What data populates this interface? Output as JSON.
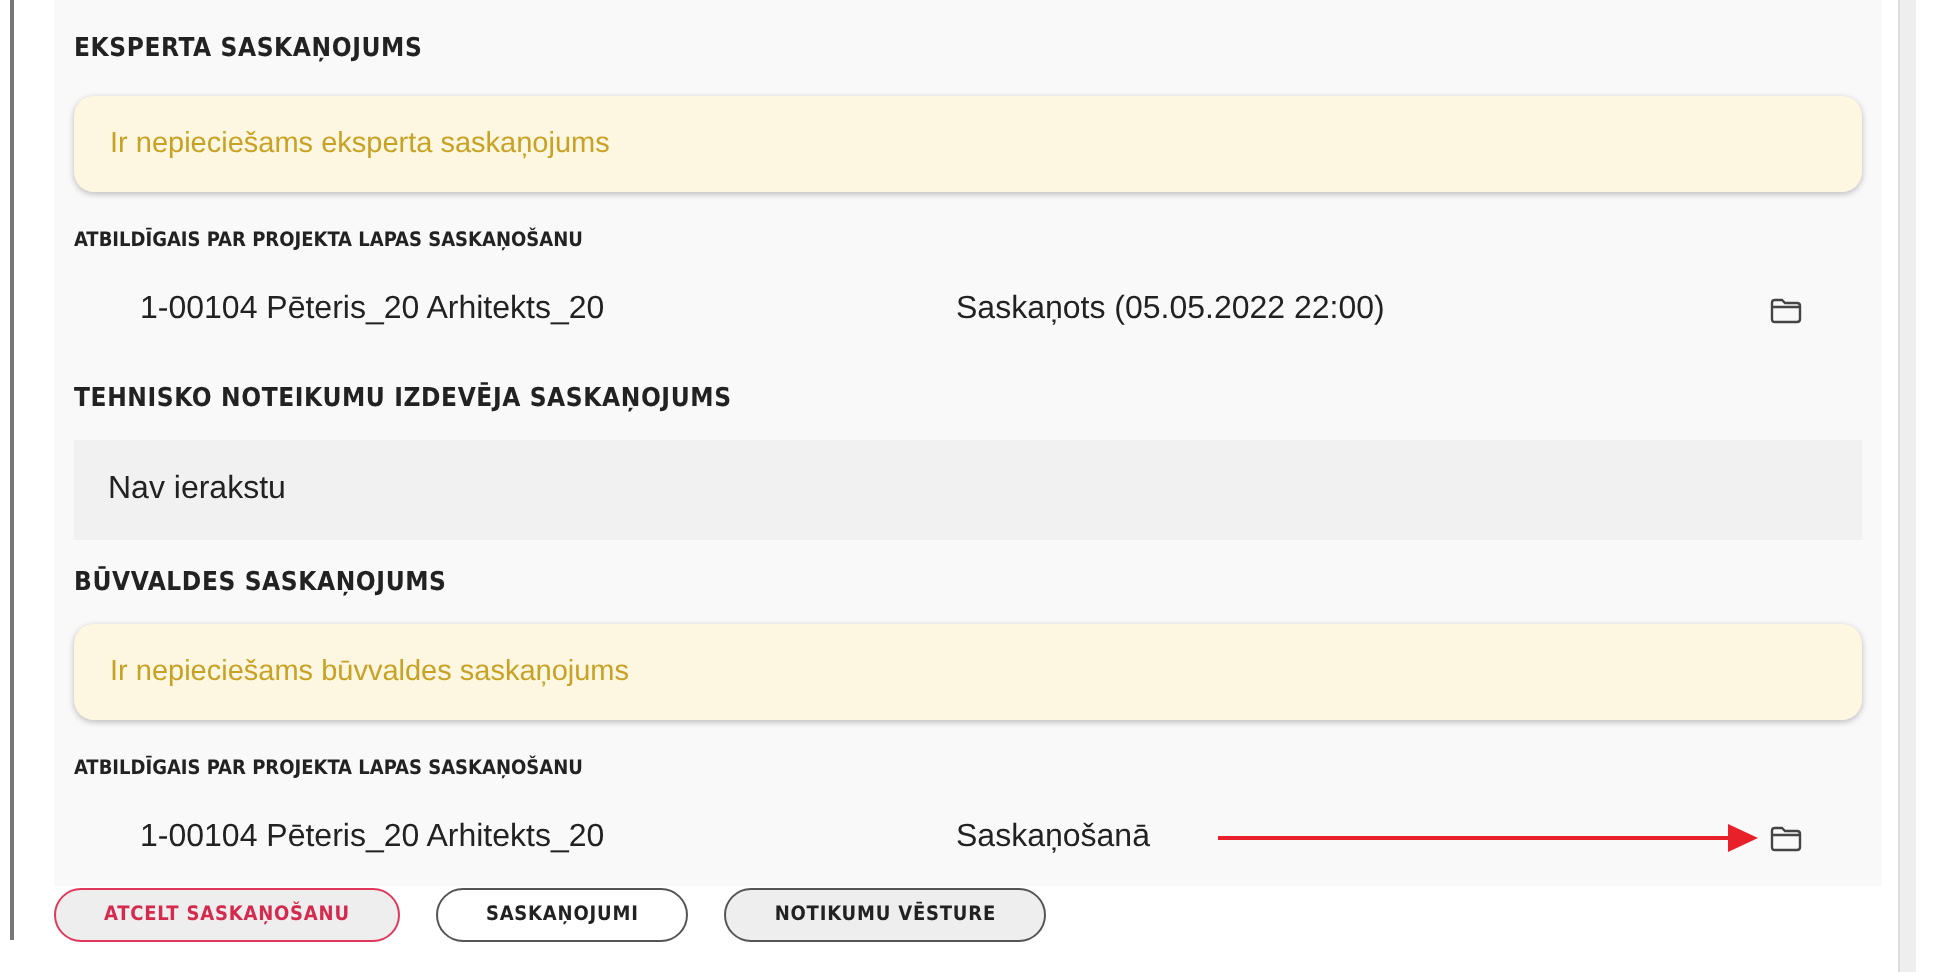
{
  "sections": [
    {
      "title": "EKSPERTA SASKAŅOJUMS",
      "blocks": [
        {
          "kind": "alert",
          "text": "Ir nepieciešams eksperta saskaņojums"
        },
        {
          "kind": "responsible",
          "label": "ATBILDĪGAIS PAR PROJEKTA LAPAS SASKAŅOŠANU",
          "rows": [
            {
              "name": "1-00104 Pēteris_20 Arhitekts_20",
              "status": "Saskaņots (05.05.2022 22:00)",
              "highlighted": false
            }
          ]
        }
      ]
    },
    {
      "title": "TEHNISKO NOTEIKUMU IZDEVĒJA SASKAŅOJUMS",
      "blocks": [
        {
          "kind": "empty",
          "text": "Nav ierakstu"
        }
      ]
    },
    {
      "title": "BŪVVALDES SASKAŅOJUMS",
      "blocks": [
        {
          "kind": "alert",
          "text": "Ir nepieciešams būvvaldes saskaņojums"
        },
        {
          "kind": "responsible",
          "label": "ATBILDĪGAIS PAR PROJEKTA LAPAS SASKAŅOŠANU",
          "rows": [
            {
              "name": "1-00104 Pēteris_20 Arhitekts_20",
              "status": "Saskaņošanā",
              "highlighted": true
            }
          ]
        }
      ]
    }
  ],
  "buttons": [
    {
      "label": "ATCELT SASKAŅOŠANU",
      "kind": "danger"
    },
    {
      "label": "SASKAŅOJUMI",
      "kind": "outline"
    },
    {
      "label": "NOTIKUMU VĒSTURE",
      "kind": "grey"
    }
  ]
}
